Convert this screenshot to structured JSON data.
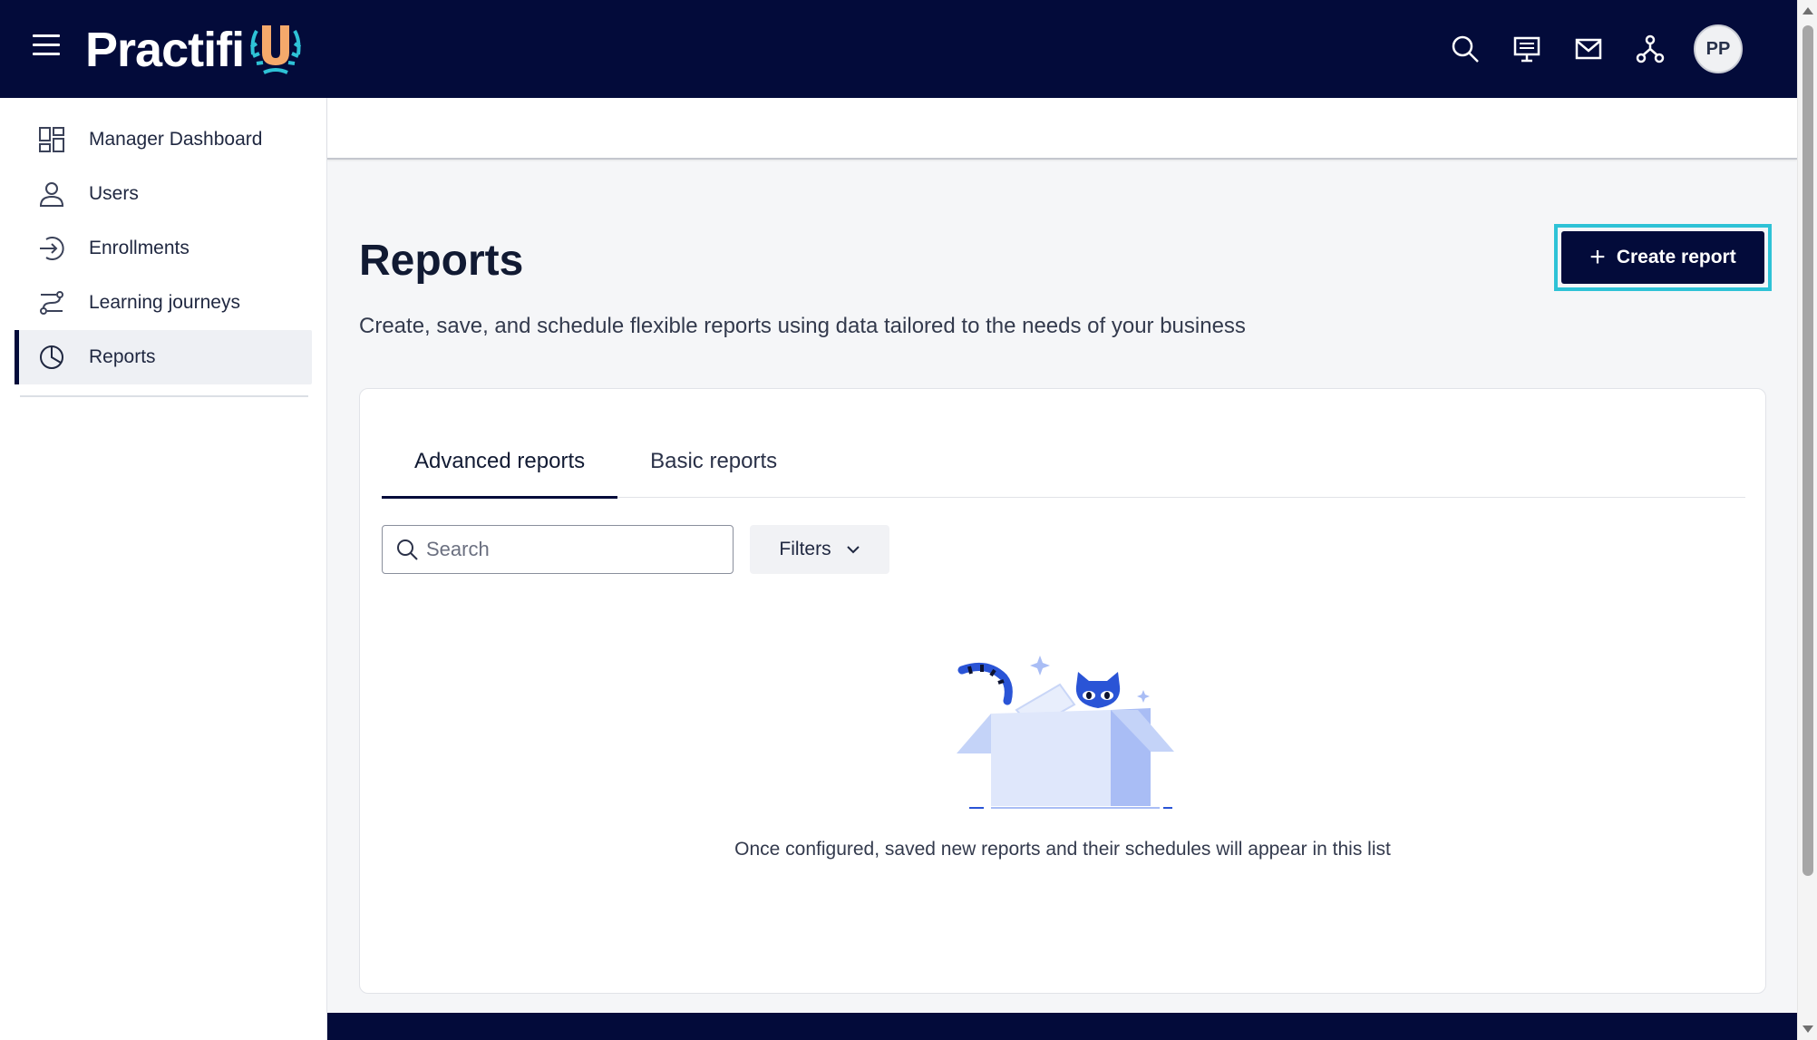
{
  "header": {
    "logo_text": "Practifi",
    "logo_badge": "U",
    "icons": [
      "menu-icon",
      "search-icon",
      "presentation-icon",
      "mail-icon",
      "org-chart-icon"
    ],
    "avatar_initials": "PP"
  },
  "sidebar": {
    "items": [
      {
        "label": "Manager Dashboard",
        "icon": "dashboard-icon"
      },
      {
        "label": "Users",
        "icon": "user-icon"
      },
      {
        "label": "Enrollments",
        "icon": "enrollment-icon"
      },
      {
        "label": "Learning journeys",
        "icon": "journey-icon"
      },
      {
        "label": "Reports",
        "icon": "pie-chart-icon",
        "active": true
      }
    ]
  },
  "main": {
    "title": "Reports",
    "description": "Create, save, and schedule flexible reports using data tailored to the needs of your business",
    "create_button_label": "Create report",
    "tabs": [
      {
        "label": "Advanced reports",
        "active": true
      },
      {
        "label": "Basic reports",
        "active": false
      }
    ],
    "search_placeholder": "Search",
    "filters_label": "Filters",
    "empty_message": "Once configured, saved new reports and their schedules will appear in this list"
  },
  "colors": {
    "brand_navy": "#030b3a",
    "focus_ring": "#2ec2d6",
    "illustration_blue": "#a9bdf5"
  }
}
